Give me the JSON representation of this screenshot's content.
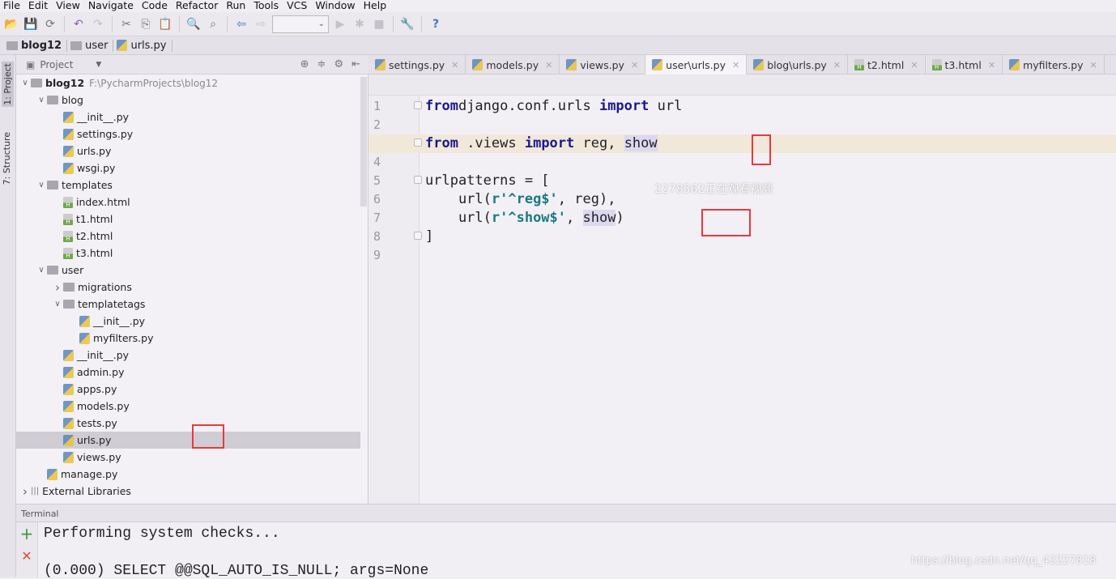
{
  "menu": [
    "File",
    "Edit",
    "View",
    "Navigate",
    "Code",
    "Refactor",
    "Run",
    "Tools",
    "VCS",
    "Window",
    "Help"
  ],
  "toolbar": {
    "icons": [
      "open-icon",
      "save-icon",
      "sync-icon",
      "undo-icon",
      "redo-icon",
      "cut-icon",
      "copy-icon",
      "paste-icon",
      "find-icon",
      "replace-icon",
      "back-icon",
      "forward-icon",
      "run-icon",
      "debug-icon",
      "stop-icon",
      "settings-icon",
      "help-icon"
    ],
    "run_config": ""
  },
  "breadcrumb": [
    "blog12",
    "user",
    "urls.py"
  ],
  "left_strip": {
    "project": "1: Project",
    "structure": "7: Structure"
  },
  "project_panel": {
    "title": "Project"
  },
  "tree": [
    {
      "label": "blog12",
      "path": "F:\\PycharmProjects\\blog12",
      "depth": 0,
      "type": "folder",
      "expanded": true,
      "bold": true
    },
    {
      "label": "blog",
      "depth": 1,
      "type": "folder",
      "expanded": true
    },
    {
      "label": "__init__.py",
      "depth": 2,
      "type": "py"
    },
    {
      "label": "settings.py",
      "depth": 2,
      "type": "py"
    },
    {
      "label": "urls.py",
      "depth": 2,
      "type": "py"
    },
    {
      "label": "wsgi.py",
      "depth": 2,
      "type": "py"
    },
    {
      "label": "templates",
      "depth": 1,
      "type": "folder",
      "expanded": true
    },
    {
      "label": "index.html",
      "depth": 2,
      "type": "html"
    },
    {
      "label": "t1.html",
      "depth": 2,
      "type": "html"
    },
    {
      "label": "t2.html",
      "depth": 2,
      "type": "html"
    },
    {
      "label": "t3.html",
      "depth": 2,
      "type": "html"
    },
    {
      "label": "user",
      "depth": 1,
      "type": "folder",
      "expanded": true
    },
    {
      "label": "migrations",
      "depth": 2,
      "type": "folder",
      "expanded": false
    },
    {
      "label": "templatetags",
      "depth": 2,
      "type": "folder",
      "expanded": true
    },
    {
      "label": "__init__.py",
      "depth": 3,
      "type": "py"
    },
    {
      "label": "myfilters.py",
      "depth": 3,
      "type": "py"
    },
    {
      "label": "__init__.py",
      "depth": 2,
      "type": "py"
    },
    {
      "label": "admin.py",
      "depth": 2,
      "type": "py"
    },
    {
      "label": "apps.py",
      "depth": 2,
      "type": "py"
    },
    {
      "label": "models.py",
      "depth": 2,
      "type": "py"
    },
    {
      "label": "tests.py",
      "depth": 2,
      "type": "py"
    },
    {
      "label": "urls.py",
      "depth": 2,
      "type": "py",
      "selected": true
    },
    {
      "label": "views.py",
      "depth": 2,
      "type": "py"
    },
    {
      "label": "manage.py",
      "depth": 1,
      "type": "py"
    },
    {
      "label": "External Libraries",
      "depth": 0,
      "type": "lib",
      "expanded": false
    }
  ],
  "tabs": [
    {
      "label": "settings.py",
      "type": "py"
    },
    {
      "label": "models.py",
      "type": "py"
    },
    {
      "label": "views.py",
      "type": "py"
    },
    {
      "label": "user\\urls.py",
      "type": "py",
      "active": true
    },
    {
      "label": "blog\\urls.py",
      "type": "py"
    },
    {
      "label": "t2.html",
      "type": "html"
    },
    {
      "label": "t3.html",
      "type": "html"
    },
    {
      "label": "myfilters.py",
      "type": "py"
    }
  ],
  "code": [
    [
      [
        "kw",
        "from"
      ],
      [
        "",
        "django.conf.urls "
      ],
      [
        "kw",
        "import"
      ],
      [
        "",
        " url"
      ]
    ],
    [],
    [
      [
        "kw",
        "from"
      ],
      [
        "",
        " .views "
      ],
      [
        "kw",
        "import"
      ],
      [
        "",
        " reg, "
      ],
      [
        "hl",
        "show"
      ]
    ],
    [],
    [
      [
        "",
        "urlpatterns = ["
      ]
    ],
    [
      [
        "",
        "    url("
      ],
      [
        "str",
        "r'^reg$'"
      ],
      [
        "",
        ", reg),"
      ]
    ],
    [
      [
        "",
        "    url("
      ],
      [
        "str",
        "r'^show$'"
      ],
      [
        "",
        ", "
      ],
      [
        "hl",
        "show"
      ],
      [
        "",
        ")"
      ]
    ],
    [
      [
        "",
        "]"
      ]
    ],
    []
  ],
  "current_line": 3,
  "terminal": {
    "title": "Terminal",
    "lines": [
      "Performing system checks...",
      "",
      "(0.000) SELECT @@SQL_AUTO_IS_NULL; args=None"
    ]
  },
  "watermarks": {
    "viewer": "2278562正在观看视频",
    "url": "https://blog.csdn.net/qq_42227818"
  },
  "colors": {
    "keyword": "#1a1a8a",
    "string": "#1b7a80",
    "highlight": "#dcd8f0",
    "annotation": "#e8393a"
  }
}
